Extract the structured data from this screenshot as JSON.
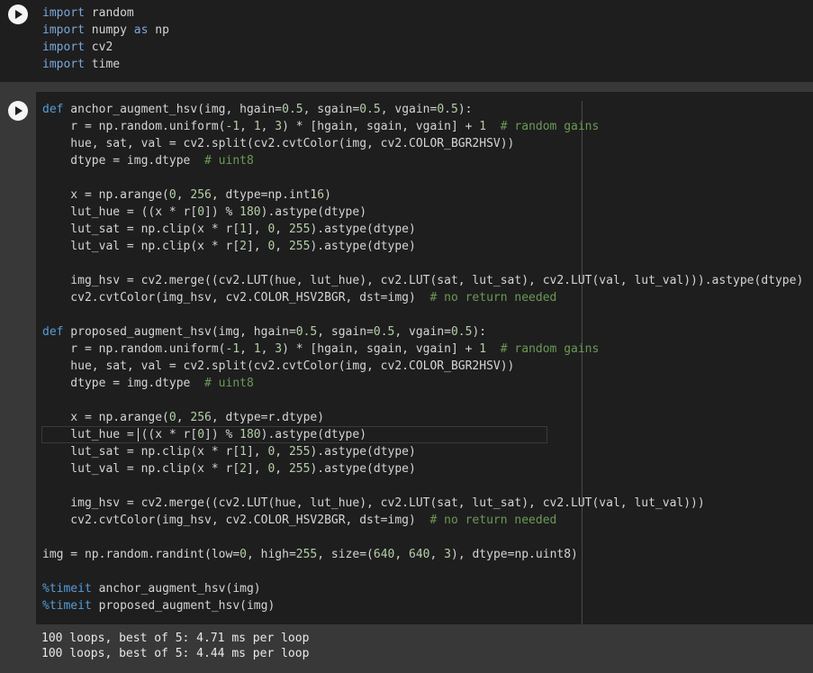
{
  "cell1": {
    "run_label": "▶",
    "lines": [
      [
        "import",
        " random"
      ],
      [
        "import",
        " numpy ",
        "as",
        " np"
      ],
      [
        "import",
        " cv2"
      ],
      [
        "import",
        " time"
      ]
    ]
  },
  "cell2": {
    "lines": [
      "def anchor_augment_hsv(img, hgain=0.5, sgain=0.5, vgain=0.5):",
      "    r = np.random.uniform(-1, 1, 3) * [hgain, sgain, vgain] + 1  # random gains",
      "    hue, sat, val = cv2.split(cv2.cvtColor(img, cv2.COLOR_BGR2HSV))",
      "    dtype = img.dtype  # uint8",
      "",
      "    x = np.arange(0, 256, dtype=np.int16)",
      "    lut_hue = ((x * r[0]) % 180).astype(dtype)",
      "    lut_sat = np.clip(x * r[1], 0, 255).astype(dtype)",
      "    lut_val = np.clip(x * r[2], 0, 255).astype(dtype)",
      "",
      "    img_hsv = cv2.merge((cv2.LUT(hue, lut_hue), cv2.LUT(sat, lut_sat), cv2.LUT(val, lut_val))).astype(dtype)",
      "    cv2.cvtColor(img_hsv, cv2.COLOR_HSV2BGR, dst=img)  # no return needed",
      "",
      "def proposed_augment_hsv(img, hgain=0.5, sgain=0.5, vgain=0.5):",
      "    r = np.random.uniform(-1, 1, 3) * [hgain, sgain, vgain] + 1  # random gains",
      "    hue, sat, val = cv2.split(cv2.cvtColor(img, cv2.COLOR_BGR2HSV))",
      "    dtype = img.dtype  # uint8",
      "",
      "    x = np.arange(0, 256, dtype=r.dtype)",
      "    lut_hue = ((x * r[0]) % 180).astype(dtype)",
      "    lut_sat = np.clip(x * r[1], 0, 255).astype(dtype)",
      "    lut_val = np.clip(x * r[2], 0, 255).astype(dtype)",
      "",
      "    img_hsv = cv2.merge((cv2.LUT(hue, lut_hue), cv2.LUT(sat, lut_sat), cv2.LUT(val, lut_val)))",
      "    cv2.cvtColor(img_hsv, cv2.COLOR_HSV2BGR, dst=img)  # no return needed",
      "",
      "img = np.random.randint(low=0, high=255, size=(640, 640, 3), dtype=np.uint8)",
      "",
      "%timeit anchor_augment_hsv(img)",
      "%timeit proposed_augment_hsv(img)"
    ]
  },
  "output": {
    "lines": [
      "100 loops, best of 5: 4.71 ms per loop",
      "100 loops, best of 5: 4.44 ms per loop"
    ]
  },
  "colors": {
    "keyword": "#7aa6da",
    "comment": "#6a9955",
    "number": "#b5cea8",
    "background": "#1e1e1e",
    "gutter": "#383838"
  }
}
